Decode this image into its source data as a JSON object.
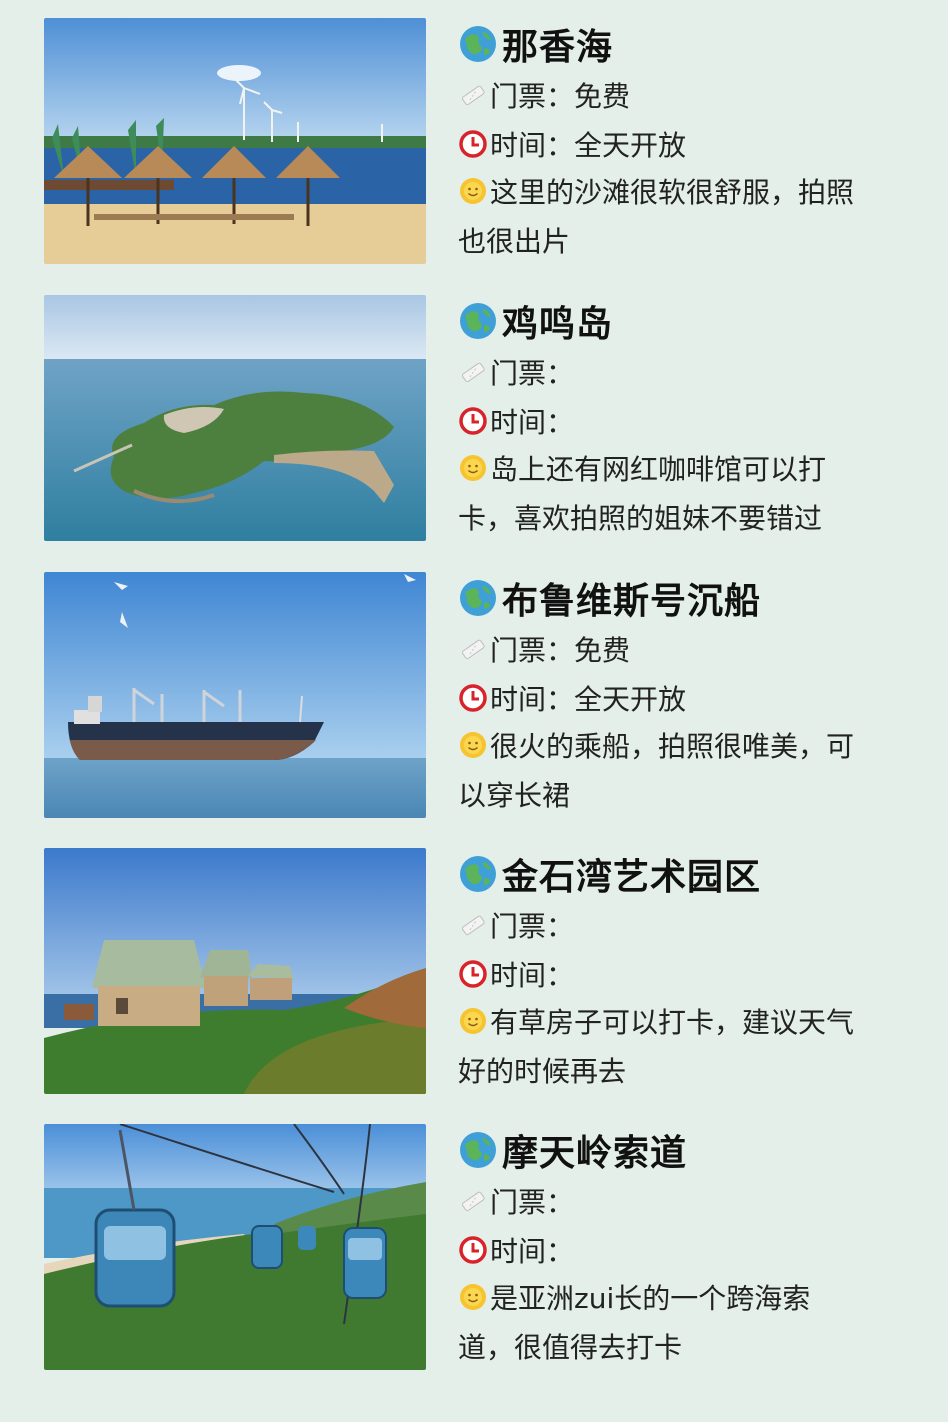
{
  "spots": [
    {
      "name": "那香海",
      "ticket_label": "门票：",
      "ticket_value": "免费",
      "time_label": "时间：",
      "time_value": "全天开放",
      "desc_line1": "这里的沙滩很软很舒服，拍照",
      "desc_line2": "也很出片",
      "photo": "beach-umbrellas-windmills"
    },
    {
      "name": "鸡鸣岛",
      "ticket_label": "门票：",
      "ticket_value": "",
      "time_label": "时间：",
      "time_value": "",
      "desc_line1": "岛上还有网红咖啡馆可以打",
      "desc_line2": "卡，喜欢拍照的姐妹不要错过",
      "photo": "island-aerial"
    },
    {
      "name": "布鲁维斯号沉船",
      "ticket_label": "门票：",
      "ticket_value": "免费",
      "time_label": "时间：",
      "time_value": "全天开放",
      "desc_line1": "很火的乘船，拍照很唯美，可",
      "desc_line2": "以穿长裙",
      "photo": "shipwreck-at-sea"
    },
    {
      "name": "金石湾艺术园区",
      "ticket_label": "门票：",
      "ticket_value": "",
      "time_label": "时间：",
      "time_value": "",
      "desc_line1": "有草房子可以打卡，建议天气",
      "desc_line2": "好的时候再去",
      "photo": "grass-roof-houses"
    },
    {
      "name": "摩天岭索道",
      "ticket_label": "门票：",
      "ticket_value": "",
      "time_label": "时间：",
      "time_value": "",
      "desc_line1": "是亚洲zui长的一个跨海索",
      "desc_line2": "道，很值得去打卡",
      "photo": "sea-cable-car"
    }
  ],
  "icons": {
    "title": "globe-icon",
    "ticket": "ticket-icon",
    "time": "clock-icon",
    "desc": "smiling-sun-icon"
  },
  "colors": {
    "background": "#e3efe8",
    "clock_red": "#d8232a",
    "sun_yellow": "#f6c431",
    "globe_blue": "#3fa0d8",
    "globe_green": "#5bb35a"
  }
}
